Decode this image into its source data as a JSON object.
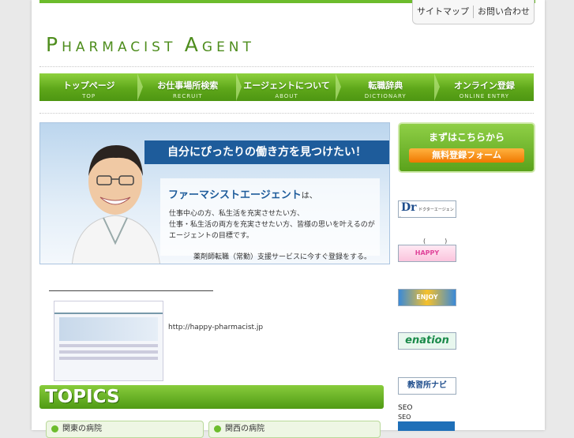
{
  "util_nav": {
    "sitemap": "サイトマップ",
    "contact": "お問い合わせ"
  },
  "logo": {
    "p": "P",
    "harmacist": "HARMACIST",
    "a": "A",
    "gent": "GENT"
  },
  "global_nav": [
    {
      "jp": "トップページ",
      "en": "TOP"
    },
    {
      "jp": "お仕事場所検索",
      "en": "RECRUIT"
    },
    {
      "jp": "エージェントについて",
      "en": "ABOUT"
    },
    {
      "jp": "転職辞典",
      "en": "DICTIONARY"
    },
    {
      "jp": "オンライン登録",
      "en": "ONLINE ENTRY"
    }
  ],
  "hero": {
    "headline": "自分にぴったりの働き方を見つけたい！",
    "brand": "ファーマシストエージェント",
    "brand_suffix": "は、",
    "desc_1": "仕事中心の方、私生活を充実させたい方、",
    "desc_2": "仕事・私生活の両方を充実させたい方、皆様の思いを叶えるのが",
    "desc_3": "エージェントの目標です。",
    "cta": "薬剤師転職（常勤）支援サービスに今すぐ登録をする。"
  },
  "side_register": {
    "title": "まずはこちらから",
    "button": "無料登録フォーム"
  },
  "side_banners": {
    "dr": "Dr",
    "dr_sub": "ドクターエージェント",
    "paren": "(　　　)",
    "happy": "HAPPY",
    "yellow": "ENJOY",
    "enation": "enation",
    "kyoshu": "教習所ナビ"
  },
  "screenshot_url": "http://happy-pharmacist.jp",
  "topics_title": "TOPICS",
  "topic_tabs": [
    "関東の病院",
    "関西の病院"
  ],
  "seo": [
    "SEO",
    "SEO"
  ],
  "colors": {
    "brand_green": "#5ea71a",
    "accent_orange": "#f07800",
    "hero_blue": "#1e5c9b"
  }
}
